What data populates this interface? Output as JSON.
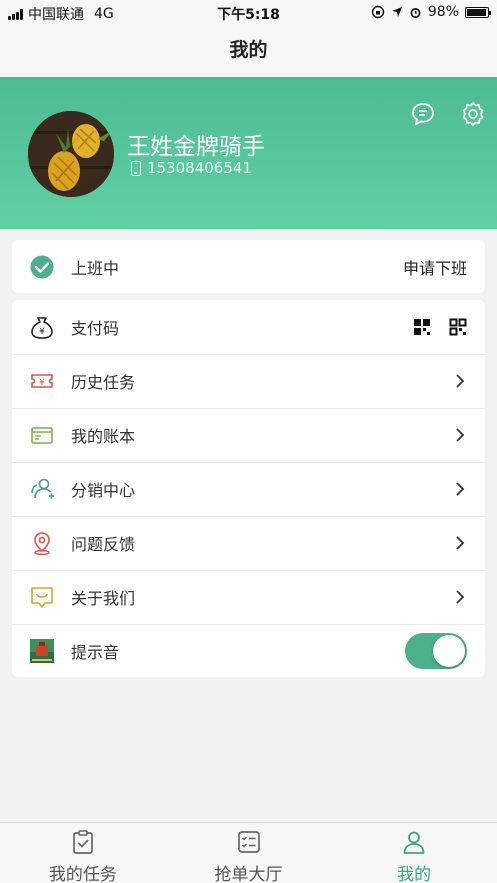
{
  "status_bar": {
    "carrier": "中国联通",
    "network": "4G",
    "time": "下午5:18",
    "battery": "98%"
  },
  "nav": {
    "title": "我的"
  },
  "profile": {
    "name": "王姓金牌骑手",
    "phone": "15308406541",
    "icons": [
      "message-icon",
      "settings-icon"
    ]
  },
  "duty": {
    "status": "上班中",
    "action": "申请下班"
  },
  "menu": [
    {
      "label": "支付码",
      "icon": "money-bag-icon"
    },
    {
      "label": "历史任务",
      "icon": "ticket-icon"
    },
    {
      "label": "我的账本",
      "icon": "card-icon"
    },
    {
      "label": "分销中心",
      "icon": "share-users-icon"
    },
    {
      "label": "问题反馈",
      "icon": "location-pin-icon"
    },
    {
      "label": "关于我们",
      "icon": "message-box-icon"
    },
    {
      "label": "提示音",
      "icon": "sound-thumbnail-icon",
      "toggle_on": true
    }
  ],
  "tabs": [
    {
      "label": "我的任务",
      "icon": "clipboard-check-icon",
      "active": false
    },
    {
      "label": "抢单大厅",
      "icon": "list-check-icon",
      "active": false
    },
    {
      "label": "我的",
      "icon": "user-icon",
      "active": true
    }
  ],
  "colors": {
    "accent": "#4cb08d",
    "header_top": "#4fbb93",
    "header_bottom": "#5fd0a4",
    "tab_active": "#3aa782"
  }
}
